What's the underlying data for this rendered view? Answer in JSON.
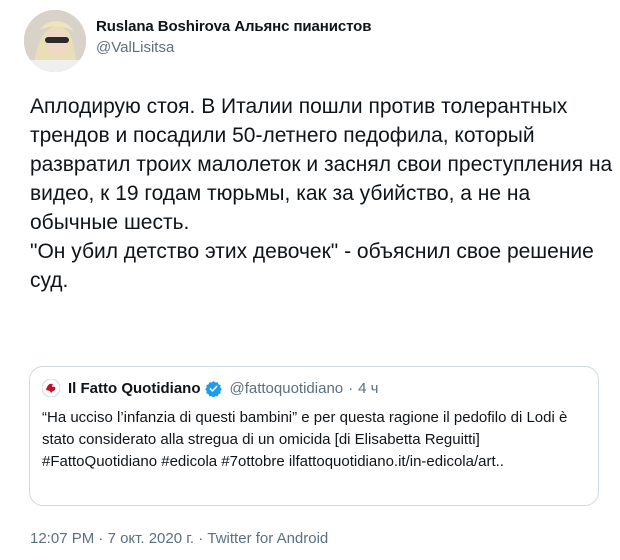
{
  "author": {
    "display_name": "Ruslana Boshirova Альянс пианистов",
    "handle": "@ValLisitsa"
  },
  "tweet": {
    "text": "Аплодирую стоя. В Италии пошли против толерантных трендов и посадили 50-летнего педофила, который развратил троих малолеток и заснял свои преступления на видео, к 19 годам тюрьмы, как за убийство, а не на обычные шесть.\n\"Он убил детство этих девочек\" - объяснил свое решение суд."
  },
  "quoted": {
    "name": "Il Fatto Quotidiano",
    "handle": "@fattoquotidiano",
    "separator": "·",
    "time": "4 ч",
    "text": "“Ha ucciso l’infanzia di questi bambini” e per questa ragione il pedofilo di Lodi è stato considerato alla stregua di un omicida [di Elisabetta Reguitti] #FattoQuotidiano #edicola #7ottobre ilfattoquotidiano.it/in-edicola/art..",
    "logo_icon": "fatto-quotidiano-logo",
    "verified_icon": "verified-badge-icon"
  },
  "footer": {
    "time": "12:07 PM",
    "sep1": " · ",
    "date": "7 окт. 2020 г.",
    "sep2": " · ",
    "source": "Twitter for Android"
  },
  "colors": {
    "text": "#0f1419",
    "secondary": "#5b7083",
    "verified": "#1d9bf0",
    "border": "#cfd9de"
  }
}
